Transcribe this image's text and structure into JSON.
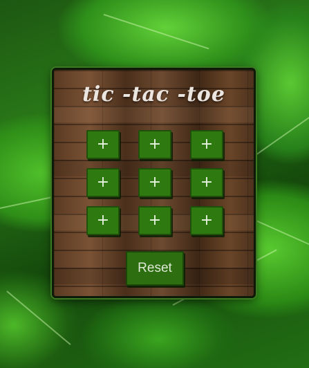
{
  "game": {
    "title": "tic -tac -toe",
    "cells": [
      "+",
      "+",
      "+",
      "+",
      "+",
      "+",
      "+",
      "+",
      "+"
    ],
    "reset_label": "Reset"
  },
  "colors": {
    "cell_fill": "#2f7a10",
    "cell_border": "#1f4f0a",
    "title_text": "#ece6e1",
    "panel_border": "#0e1a08"
  }
}
